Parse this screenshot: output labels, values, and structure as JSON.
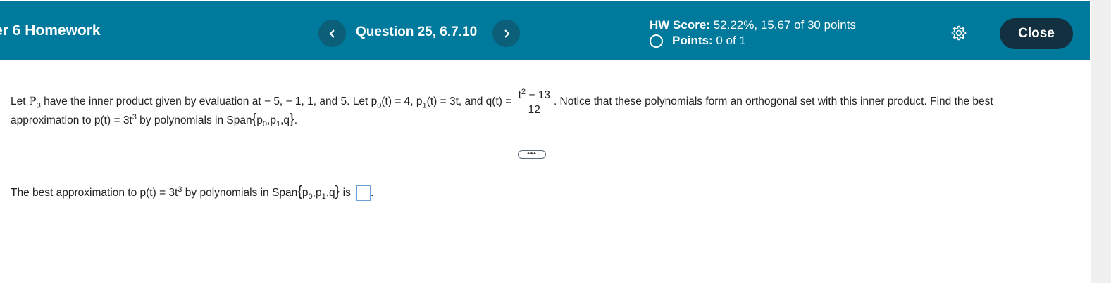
{
  "header": {
    "assignment_title": "er 6 Homework",
    "prev_label": "‹",
    "question_label": "Question 25, 6.7.10",
    "next_label": "›",
    "hw_score_label": "HW Score:",
    "hw_score_value": "52.22%, 15.67 of 30 points",
    "points_label": "Points:",
    "points_value": "0 of 1",
    "close_label": "Close",
    "colors": {
      "bar": "#007a9c",
      "close_bg": "#12303f",
      "nav_bg": "#0b5f79"
    }
  },
  "question": {
    "l1_a": "Let ",
    "l1_P": "ℙ",
    "l1_P_sub": "3",
    "l1_b": " have the inner product given by evaluation at  − 5,  − 1, 1, and 5. Let ",
    "l1_p0": "p",
    "l1_p0_sub": "0",
    "l1_c": "(t) = 4, ",
    "l1_p1": "p",
    "l1_p1_sub": "1",
    "l1_d": "(t) = 3t, and q(t) = ",
    "frac_num": "t",
    "frac_num_sup": "2",
    "frac_num_rest": " − 13",
    "frac_den": "12",
    "l1_e": ". Notice that these polynomials form an orthogonal set with this inner product. Find the best",
    "l2_a": "approximation to p(t) = 3t",
    "l2_sup": "3",
    "l2_b": " by polynomials in Span",
    "brace_open": "{",
    "span_p0": "p",
    "span_p0_sub": "0",
    "span_sep1": ",",
    "span_p1": "p",
    "span_p1_sub": "1",
    "span_sep2": ",q",
    "brace_close": "}",
    "l2_end": "."
  },
  "divider": {
    "more_label": "•••"
  },
  "answer": {
    "a": "The best approximation to p(t) = 3t",
    "sup": "3",
    "b": " by polynomials in Span",
    "brace_open": "{",
    "p0": "p",
    "p0_sub": "0",
    "sep1": ",",
    "p1": "p",
    "p1_sub": "1",
    "sep2": ",q",
    "brace_close": "}",
    "c": " is ",
    "end": "."
  }
}
